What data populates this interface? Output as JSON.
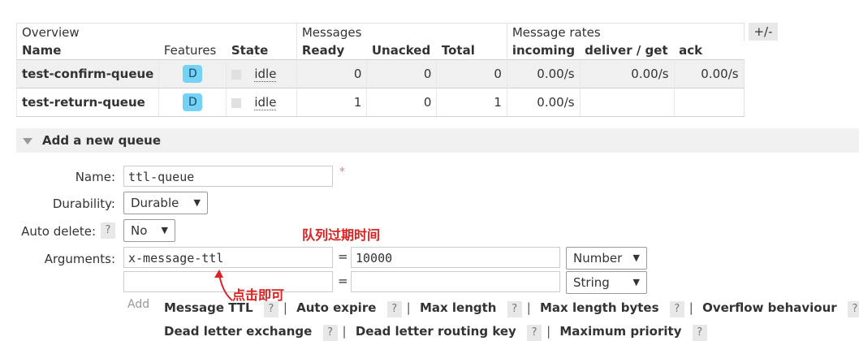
{
  "table": {
    "group_headers": [
      "Overview",
      "Messages",
      "Message rates"
    ],
    "toggle": "+/-",
    "columns": [
      "Name",
      "Features",
      "State",
      "Ready",
      "Unacked",
      "Total",
      "incoming",
      "deliver / get",
      "ack"
    ],
    "rows": [
      {
        "name": "test-confirm-queue",
        "feature": "D",
        "state": "idle",
        "ready": "0",
        "unacked": "0",
        "total": "0",
        "incoming": "0.00/s",
        "deliver": "0.00/s",
        "ack": "0.00/s"
      },
      {
        "name": "test-return-queue",
        "feature": "D",
        "state": "idle",
        "ready": "1",
        "unacked": "0",
        "total": "1",
        "incoming": "0.00/s",
        "deliver": "",
        "ack": ""
      }
    ]
  },
  "form": {
    "section_title": "Add a new queue",
    "name_label": "Name:",
    "name_value": "ttl-queue",
    "required_mark": "*",
    "durability_label": "Durability:",
    "durability_value": "Durable",
    "auto_delete_label": "Auto delete:",
    "auto_delete_help": "?",
    "auto_delete_value": "No",
    "arguments_label": "Arguments:",
    "arg1_key": "x-message-ttl",
    "arg1_eq": "=",
    "arg1_value": "10000",
    "arg1_type": "Number",
    "arg2_key": "",
    "arg2_eq": "=",
    "arg2_value": "",
    "arg2_type": "String",
    "add_label": "Add",
    "hints_line1": [
      "Message TTL",
      "Auto expire",
      "Max length",
      "Max length bytes",
      "Overflow behaviour"
    ],
    "hints_line2": [
      "Dead letter exchange",
      "Dead letter routing key",
      "Maximum priority"
    ],
    "help": "?",
    "sep": "|"
  },
  "annotations": {
    "title_note": "队列过期时间",
    "click_note": "点击即可",
    "color": "#e02020"
  }
}
